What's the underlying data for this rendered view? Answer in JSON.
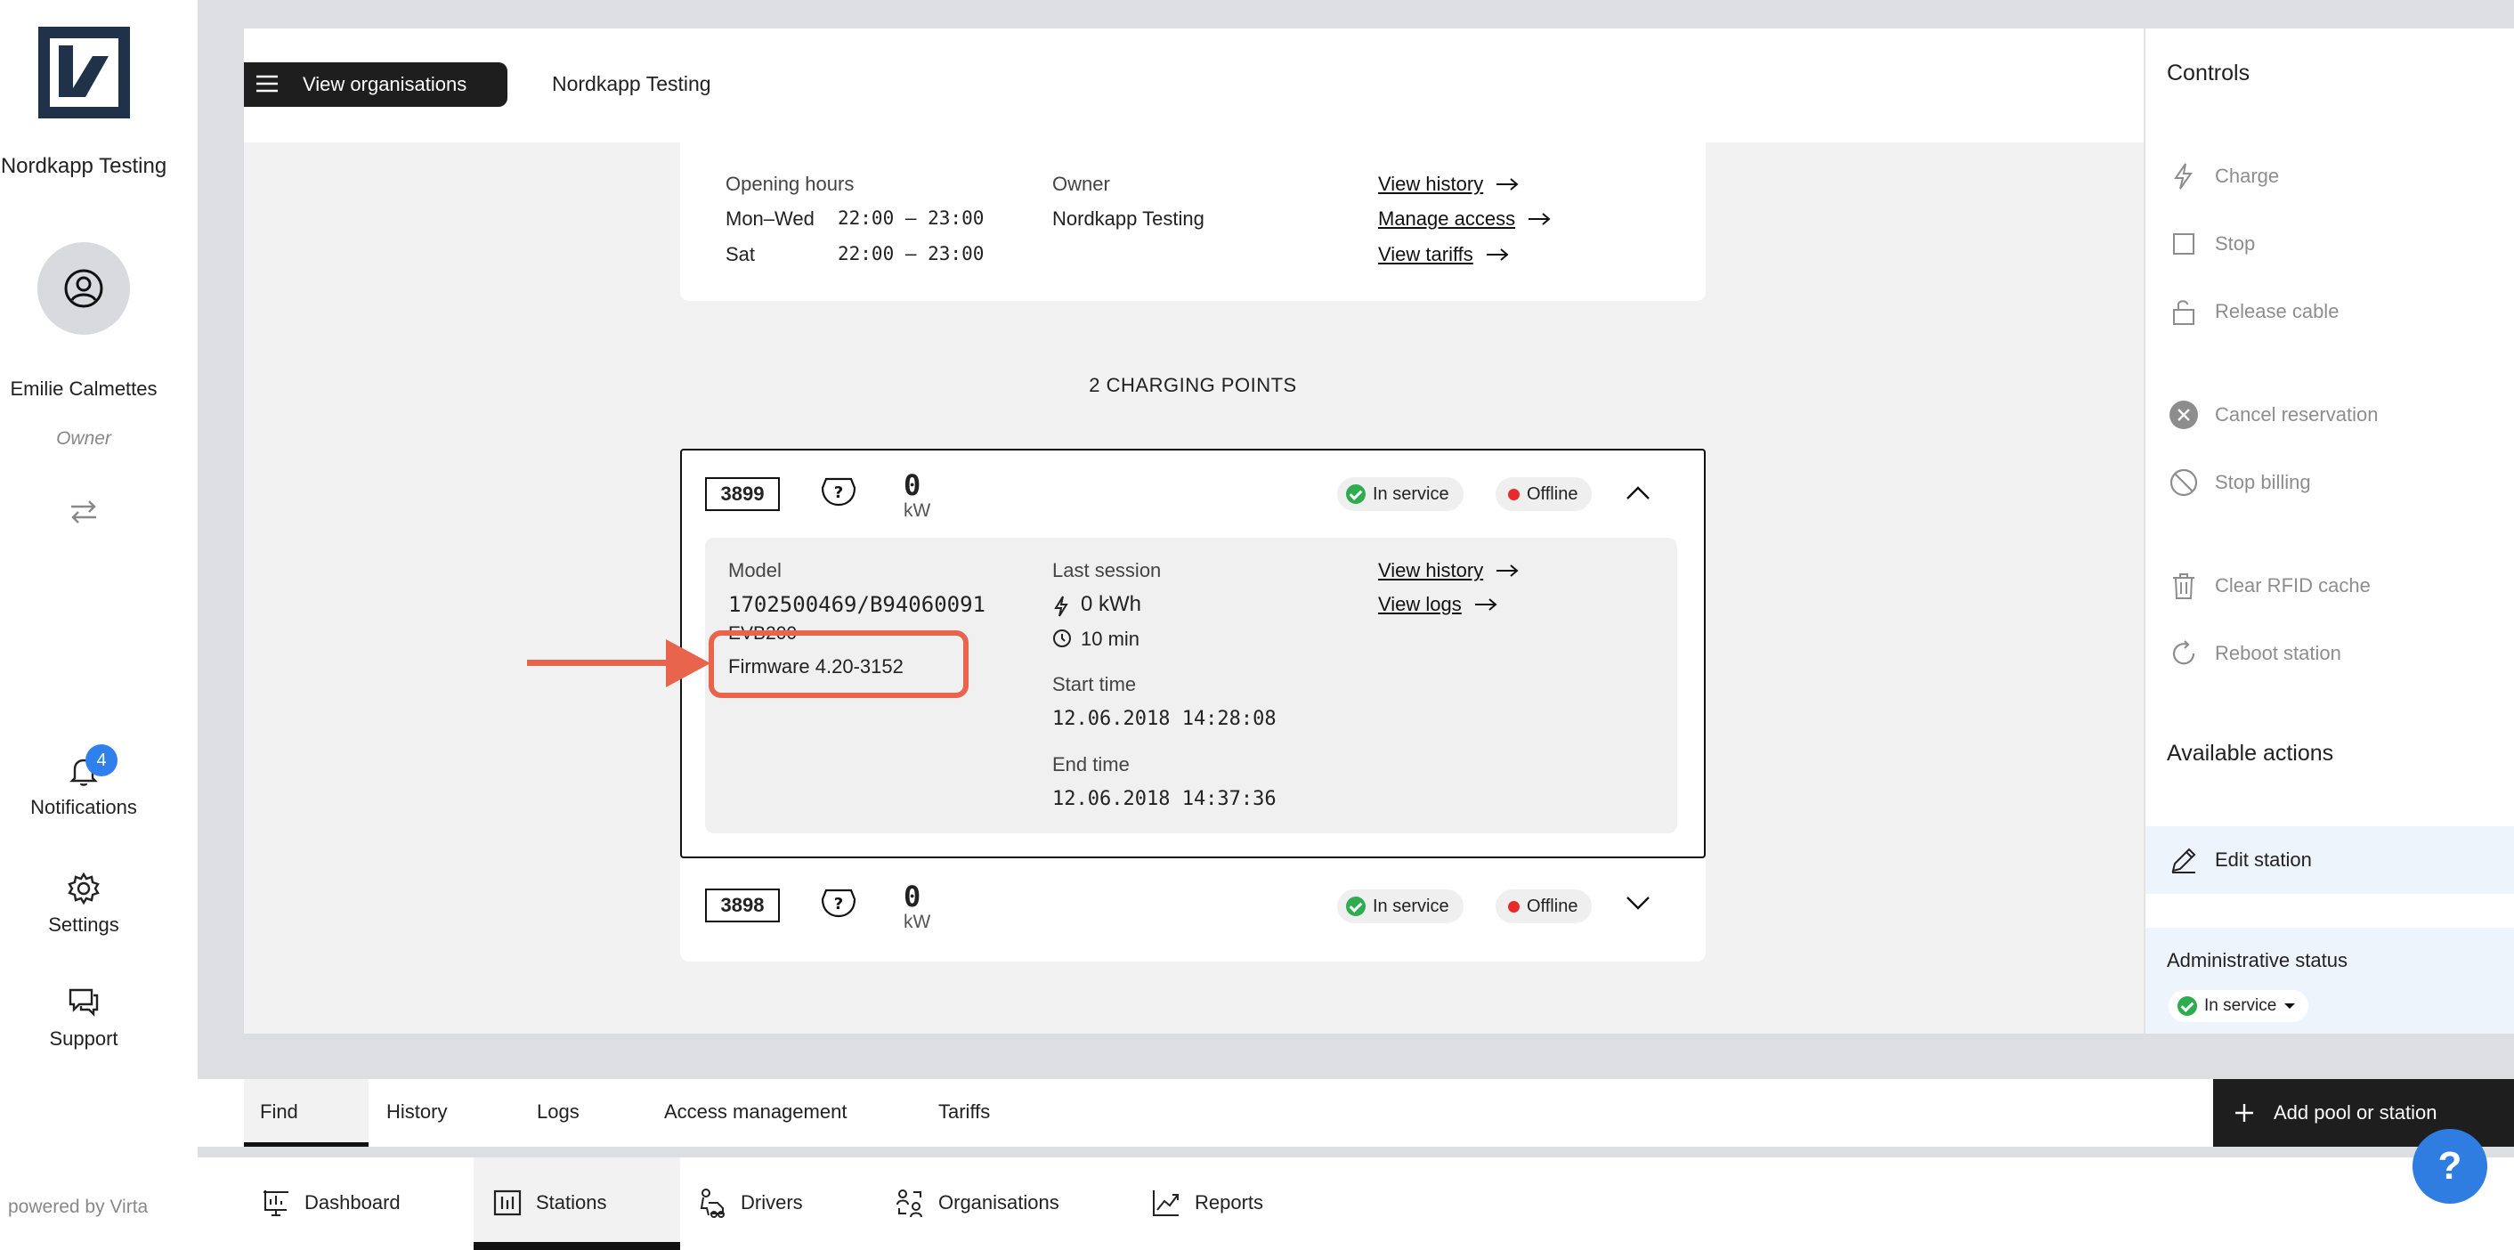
{
  "sidebar": {
    "org_name": "Nordkapp Testing",
    "user_name": "Emilie Calmettes",
    "user_role": "Owner",
    "notifications_label": "Notifications",
    "notifications_count": "4",
    "settings_label": "Settings",
    "support_label": "Support",
    "powered_by": "powered by Virta"
  },
  "header": {
    "view_orgs_label": "View organisations",
    "breadcrumb": "Nordkapp Testing"
  },
  "station": {
    "opening_hours_label": "Opening hours",
    "hours": [
      {
        "days": "Mon–Wed",
        "time": "22:00 – 23:00"
      },
      {
        "days": "Sat",
        "time": "22:00 – 23:00"
      }
    ],
    "owner_label": "Owner",
    "owner_value": "Nordkapp Testing",
    "links": [
      "View history",
      "Manage access",
      "View tariffs"
    ],
    "charging_points_title": "2 CHARGING POINTS"
  },
  "charging_points": [
    {
      "id": "3899",
      "kw": "0",
      "unit": "kW",
      "service_status": "In service",
      "connection_status": "Offline",
      "model_label": "Model",
      "model_value": "1702500469/B94060091",
      "model_line2": "EVB200",
      "firmware": "Firmware 4.20-3152",
      "last_session_label": "Last session",
      "energy": "0 kWh",
      "duration": "10 min",
      "start_label": "Start time",
      "start_value": "12.06.2018 14:28:08",
      "end_label": "End time",
      "end_value": "12.06.2018 14:37:36",
      "links": [
        "View history",
        "View logs"
      ]
    },
    {
      "id": "3898",
      "kw": "0",
      "unit": "kW",
      "service_status": "In service",
      "connection_status": "Offline"
    }
  ],
  "controls": {
    "title": "Controls",
    "items": [
      "Charge",
      "Stop",
      "Release cable",
      "Cancel reservation",
      "Stop billing",
      "Clear RFID cache",
      "Reboot station"
    ],
    "available_title": "Available actions",
    "edit_label": "Edit station",
    "admin_status_label": "Administrative status",
    "admin_status_value": "In service"
  },
  "subtabs": [
    "Find",
    "History",
    "Logs",
    "Access management",
    "Tariffs"
  ],
  "add_button_label": "Add pool or station",
  "bottom_nav": [
    "Dashboard",
    "Stations",
    "Drivers",
    "Organisations",
    "Reports"
  ],
  "colors": {
    "accent_blue": "#2f80ed",
    "annotation": "#e8644c",
    "status_green": "#2eac4f",
    "status_red": "#e52b2b",
    "dark": "#1e1e1e"
  }
}
